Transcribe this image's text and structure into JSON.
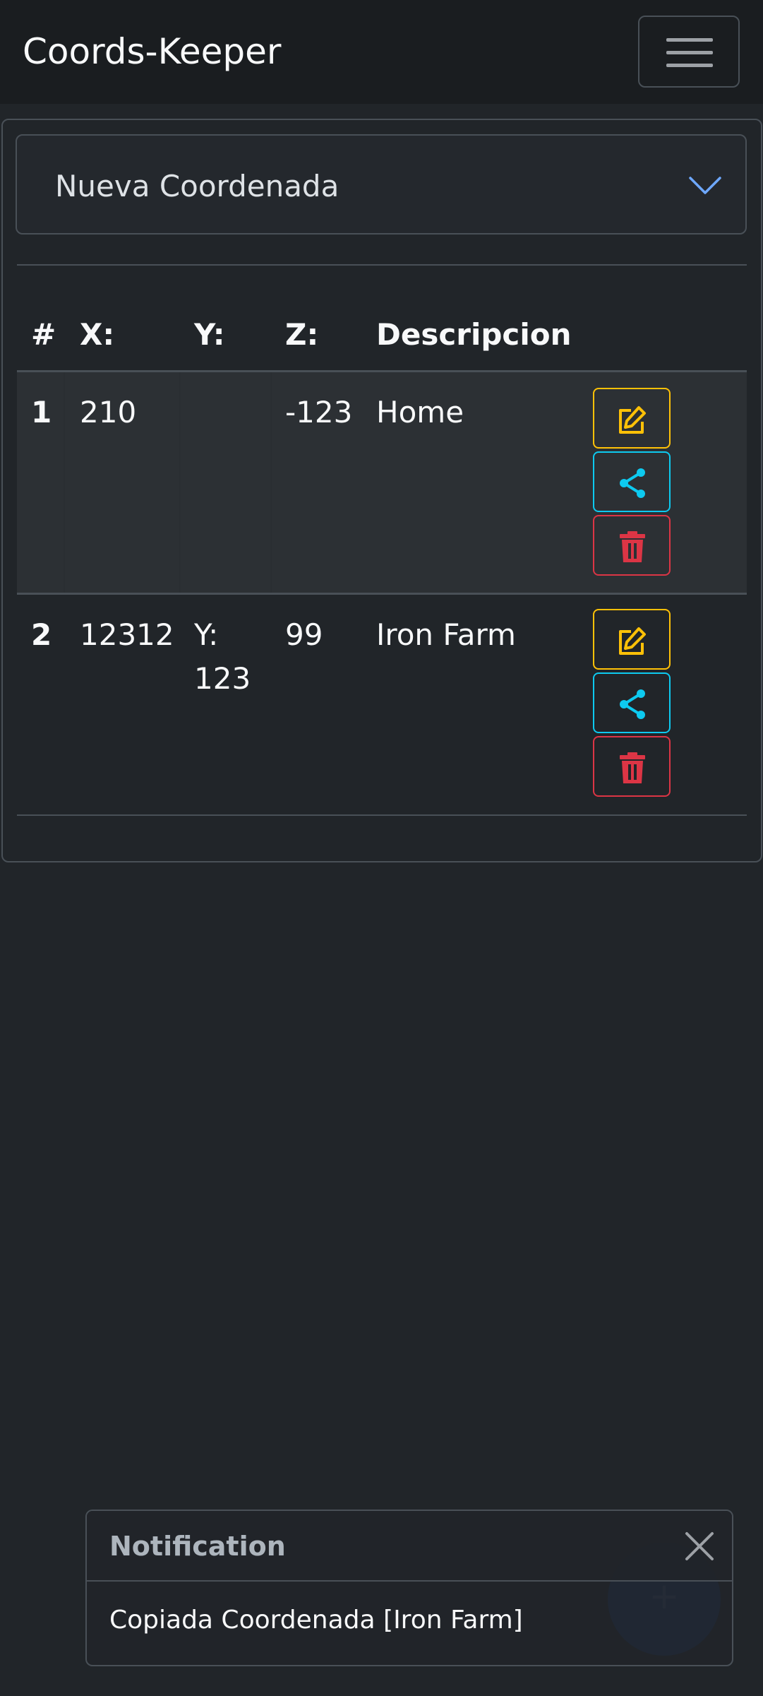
{
  "navbar": {
    "brand": "Coords-Keeper"
  },
  "accordion": {
    "label": "Nueva Coordenada"
  },
  "table": {
    "headers": [
      "#",
      "X:",
      "Y:",
      "Z:",
      "Descripcion"
    ],
    "rows": [
      {
        "num": "1",
        "x": "210",
        "y": "",
        "z": "-123",
        "desc": "Home"
      },
      {
        "num": "2",
        "x": "12312",
        "y": "Y: 123",
        "z": "99",
        "desc": "Iron Farm"
      }
    ]
  },
  "fab": {
    "label": "+"
  },
  "toast": {
    "title": "Notification",
    "message": "Copiada Coordenada [Iron Farm]"
  },
  "colors": {
    "edit": "#ffc107",
    "share": "#0dcaf0",
    "delete": "#dc3545",
    "accent": "#6ea8fe"
  }
}
